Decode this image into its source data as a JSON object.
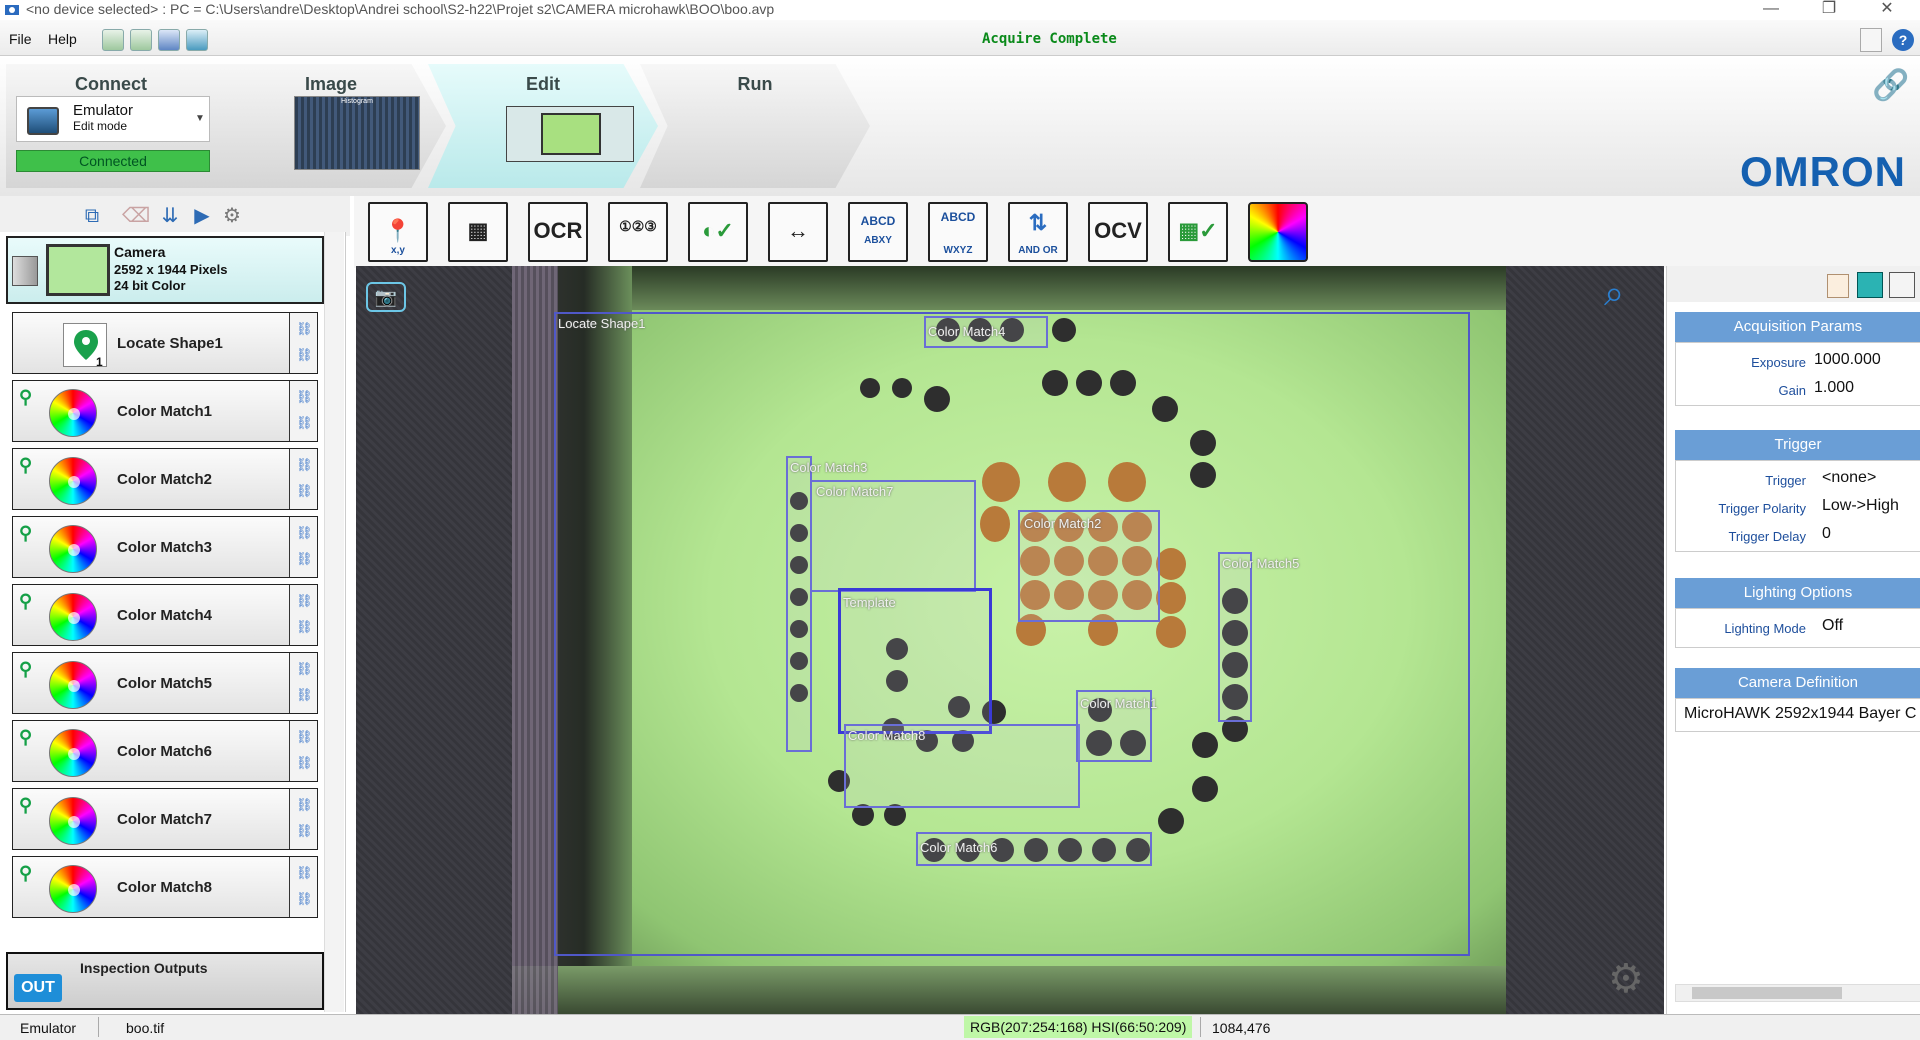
{
  "window": {
    "title": "<no device selected> : PC = C:\\Users\\andre\\Desktop\\Andrei school\\S2-h22\\Projet s2\\CAMERA microhawk\\BOO\\boo.avp",
    "minimize": "—",
    "restore": "❐",
    "close": "✕"
  },
  "menu": {
    "file": "File",
    "help": "Help"
  },
  "status_message": "Acquire Complete",
  "steps": {
    "connect": "Connect",
    "image": "Image",
    "edit": "Edit",
    "run": "Run",
    "image_thumb_label": "Histogram"
  },
  "connect_panel": {
    "device": "Emulator",
    "mode": "Edit mode",
    "state": "Connected"
  },
  "brand": "OMRON",
  "camera_card": {
    "title": "Camera",
    "resolution": "2592 x 1944 Pixels",
    "color": "24 bit Color"
  },
  "tools": [
    {
      "label": "Locate Shape1"
    },
    {
      "label": "Color Match1"
    },
    {
      "label": "Color Match2"
    },
    {
      "label": "Color Match3"
    },
    {
      "label": "Color Match4"
    },
    {
      "label": "Color Match5"
    },
    {
      "label": "Color Match6"
    },
    {
      "label": "Color Match7"
    },
    {
      "label": "Color Match8"
    }
  ],
  "inspection_outputs": {
    "label": "Inspection Outputs",
    "badge": "OUT"
  },
  "ribbon": [
    {
      "icon": "locate-icon",
      "text": "📍",
      "sub": "x,y"
    },
    {
      "icon": "datamatrix-icon",
      "text": "▦",
      "sub": ""
    },
    {
      "icon": "ocr-icon",
      "text": "OCR",
      "sub": ""
    },
    {
      "icon": "count-icon",
      "text": "①②③",
      "sub": ""
    },
    {
      "icon": "presence-icon",
      "text": "◐✓",
      "sub": ""
    },
    {
      "icon": "measure-icon",
      "text": "↔",
      "sub": ""
    },
    {
      "icon": "text-compare-icon",
      "text": "ABCD",
      "sub": "ABXY"
    },
    {
      "icon": "text-match-icon",
      "text": "ABCD",
      "sub": "WXYZ"
    },
    {
      "icon": "logic-icon",
      "text": "⇅",
      "sub": "AND OR"
    },
    {
      "icon": "ocv-icon",
      "text": "OCV",
      "sub": ""
    },
    {
      "icon": "verify-icon",
      "text": "▦✓",
      "sub": ""
    },
    {
      "icon": "color-icon",
      "text": "",
      "sub": ""
    }
  ],
  "rois": {
    "locate": "Locate Shape1",
    "cm1": "Color Match1",
    "cm2": "Color Match2",
    "cm3": "Color Match3",
    "cm4": "Color Match4",
    "cm5": "Color Match5",
    "cm6": "Color Match6",
    "cm7": "Color Match7",
    "cm8": "Color Match8",
    "template": "Template"
  },
  "right_panel": {
    "acq": {
      "header": "Acquisition Params",
      "exposure_label": "Exposure",
      "exposure": "1000.000",
      "gain_label": "Gain",
      "gain": "1.000"
    },
    "trigger": {
      "header": "Trigger",
      "trigger_label": "Trigger",
      "trigger": "<none>",
      "polarity_label": "Trigger Polarity",
      "polarity": "Low->High",
      "delay_label": "Trigger Delay",
      "delay": "0"
    },
    "lighting": {
      "header": "Lighting Options",
      "mode_label": "Lighting Mode",
      "mode": "Off"
    },
    "camdef": {
      "header": "Camera Definition",
      "value": "MicroHAWK 2592x1944 Bayer C"
    }
  },
  "statusbar": {
    "device": "Emulator",
    "file": "boo.tif",
    "color": "RGB(207:254:168)  HSI(66:50:209)",
    "coords": "1084,476"
  },
  "colors": {
    "accent": "#6a9ed6",
    "connected": "#3fc04a",
    "status_ok": "#0a8a1a",
    "brand": "#1560b0"
  }
}
